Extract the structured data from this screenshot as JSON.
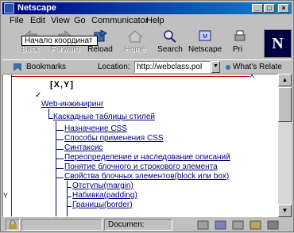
{
  "window": {
    "title": "Netscape"
  },
  "menu": [
    "File",
    "Edit",
    "View",
    "Go",
    "Communicator",
    "Help"
  ],
  "toolbar": {
    "items": [
      {
        "label": "Back",
        "icon": "back-arrow-icon"
      },
      {
        "label": "Forward",
        "icon": "forward-arrow-icon"
      },
      {
        "label": "Reload",
        "icon": "reload-icon"
      },
      {
        "label": "Home",
        "icon": "home-icon"
      },
      {
        "label": "Search",
        "icon": "search-icon"
      },
      {
        "label": "Netscape",
        "icon": "netscape-icon"
      },
      {
        "label": "Pri",
        "icon": "print-icon"
      }
    ],
    "tooltip": "Начало координат"
  },
  "location": {
    "bookmarks_label": "Bookmarks",
    "location_label": "Location:",
    "url": "http://webclass.pol",
    "whats_related": "What's Relate"
  },
  "content": {
    "axis_labels": {
      "xy": "[X,Y]",
      "x": "X",
      "y": "Y"
    },
    "tree": {
      "root": "Web-инжиниринг",
      "child": "Каскадные таблицы стилей",
      "items": [
        "Назначение CSS",
        "Способы применения CSS",
        "Синтаксис",
        "Переопределение и наследование описаний",
        "Понятие блочного и строкового элемента",
        "Свойства блочных элементов(block или box)"
      ],
      "subitems": [
        "Отступы(margin)",
        "Набивка(padding)",
        "Границы(border)"
      ]
    }
  },
  "status": {
    "text": "Documen:"
  }
}
